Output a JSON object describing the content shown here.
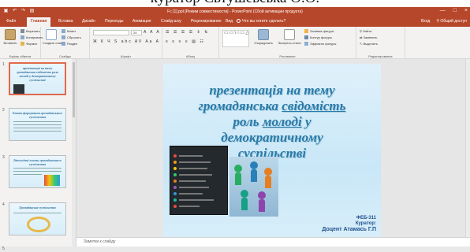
{
  "caption": {
    "text": "куратор Євтушевська О.О."
  },
  "window": {
    "title": "Fc [1].ppt [Режим совместимости] - PowerPoint (Сбой активации продукта)",
    "qat": [
      "save-icon",
      "undo-icon",
      "redo-icon",
      "slideshow-icon"
    ],
    "controls": [
      "—",
      "□",
      "×"
    ],
    "controls_icons": [
      "minimize-icon",
      "maximize-icon",
      "close-icon"
    ]
  },
  "tabs": {
    "items": [
      "Файл",
      "Главная",
      "Вставка",
      "Дизайн",
      "Переходы",
      "Анимация",
      "Слайд-шоу",
      "Рецензирование",
      "Вид"
    ],
    "active": "Главная",
    "tellme": "Что вы хотите сделать?",
    "signin": "Вход",
    "share": "Общий доступ"
  },
  "ribbon": {
    "clipboard": {
      "paste": "Вставить",
      "cut": "Вырезать",
      "copy": "Копировать",
      "format": "Формат",
      "group": "Буфер обмена"
    },
    "slides": {
      "create": "Создать слайд",
      "layout": "Макет",
      "reset": "Сбросить",
      "section": "Раздел",
      "group": "Слайды"
    },
    "font": {
      "name": "",
      "size": "24",
      "row1": "A A  A",
      "row2": "Ж К Ч S abc AV Aa A",
      "group": "Шрифт"
    },
    "paragraph": {
      "row1": "☰ ☰ ☰ ☰ ⇕ ⇅",
      "row2": "≡ ≡ ≡ ≡ ▤ ☷",
      "group": "Абзац"
    },
    "drawing": {
      "shapes_preview": "▭▭\\○▭△⌐⌐⟨⌐▷☆{",
      "arrange": "Упорядочить",
      "quickstyles": "Экспресс-стили",
      "fill": "Заливка фигуры",
      "outline": "Контур фигуры",
      "effects": "Эффекты фигуры",
      "group": "Рисование"
    },
    "editing": {
      "find": "Найти",
      "replace": "Заменить",
      "select": "Выделить",
      "group": "Редактирование"
    }
  },
  "thumbnails": [
    {
      "num": "1",
      "title": "презентація на тему громадянська свідомість роль молоді у демократичному суспільстві"
    },
    {
      "num": "2",
      "title": "Етапи формування громадянського суспільства"
    },
    {
      "num": "3",
      "title": "Ідеологічні основи громадянського суспільства"
    },
    {
      "num": "4",
      "title": "Громадянське суспільство"
    },
    {
      "num": "5",
      "title": ""
    }
  ],
  "slide": {
    "title_line1": "презентація на тему",
    "title_line2a": "громадянська ",
    "title_line2b": "свідомість",
    "title_line3a": "роль ",
    "title_line3b": "молоді",
    "title_line3c": " у",
    "title_line4": "демократичному",
    "title_line5": "суспільстві",
    "group": "ФЕБ-311",
    "curator_label": "Куратор:",
    "curator": "Доцент Атамась Г.П"
  },
  "notes": {
    "placeholder": "Заметки к слайду"
  },
  "status": {
    "slide_num": "5"
  }
}
